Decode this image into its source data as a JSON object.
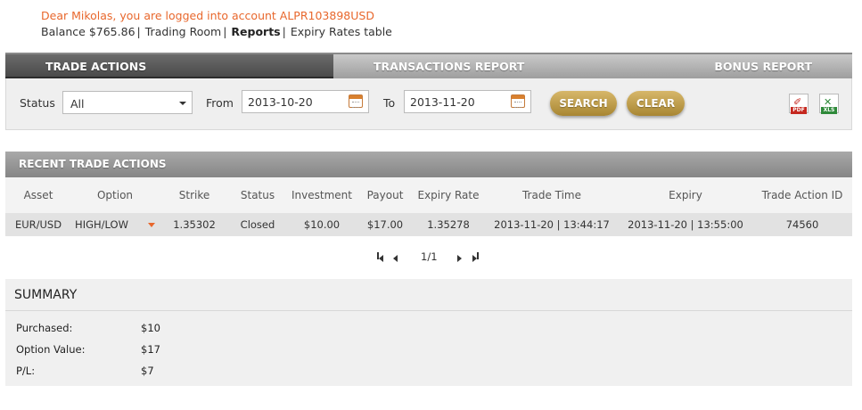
{
  "header": {
    "greeting": "Dear Mikolas, you are logged into account ALPR103898USD",
    "balance": "Balance $765.86",
    "sep": "|",
    "trading_room": "Trading Room",
    "reports": "Reports",
    "expiry_rates": "Expiry Rates table"
  },
  "tabs": [
    {
      "label": "TRADE ACTIONS",
      "active": true
    },
    {
      "label": "TRANSACTIONS REPORT",
      "active": false
    },
    {
      "label": "BONUS REPORT",
      "active": false
    }
  ],
  "filters": {
    "status_label": "Status",
    "status_value": "All",
    "from_label": "From",
    "from_value": "2013-10-20",
    "to_label": "To",
    "to_value": "2013-11-20",
    "search_label": "SEARCH",
    "clear_label": "CLEAR",
    "pdf_tag": "PDF",
    "xls_tag": "XLS"
  },
  "recent": {
    "title": "RECENT TRADE ACTIONS",
    "columns": [
      "Asset",
      "Option",
      "Strike",
      "Status",
      "Investment",
      "Payout",
      "Expiry Rate",
      "Trade Time",
      "Expiry",
      "Trade Action ID"
    ],
    "rows": [
      [
        "EUR/USD",
        "HIGH/LOW",
        "1.35302",
        "Closed",
        "$10.00",
        "$17.00",
        "1.35278",
        "2013-11-20 | 13:44:17",
        "2013-11-20 | 13:55:00",
        "74560"
      ]
    ]
  },
  "pagination": {
    "page": "1/1"
  },
  "summary": {
    "title": "SUMMARY",
    "purchased_label": "Purchased:",
    "purchased_value": "$10",
    "option_value_label": "Option Value:",
    "option_value_value": "$17",
    "pl_label": "P/L:",
    "pl_value": "$7"
  },
  "colors": {
    "accent_orange": "#e8672c",
    "gold_button": "#c4a04a",
    "payout_red": "#cc1f2f"
  },
  "icons": [
    "calendar-icon",
    "pdf-icon",
    "excel-icon",
    "first-page-icon",
    "prev-page-icon",
    "next-page-icon",
    "last-page-icon",
    "dropdown-caret-icon"
  ]
}
